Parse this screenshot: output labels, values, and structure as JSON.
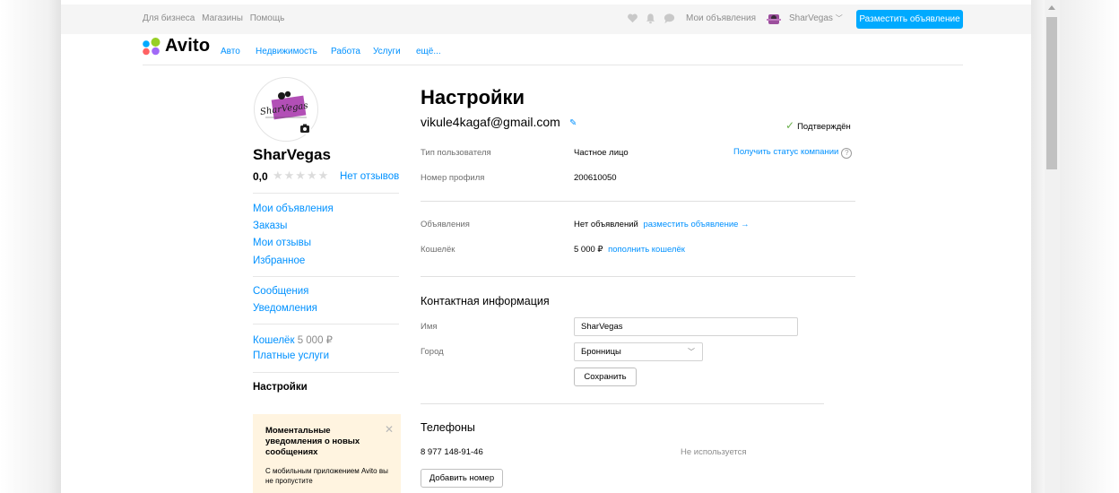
{
  "topbar": {
    "links": [
      "Для бизнеса",
      "Магазины",
      "Помощь"
    ],
    "icons": [
      "heart-icon",
      "bell-icon",
      "chat-icon"
    ],
    "my_ads": "Мои объявления",
    "username": "SharVegas",
    "post_button": "Разместить объявление"
  },
  "nav": {
    "logo": "Avito",
    "items": [
      "Авто",
      "Недвижимость",
      "Работа",
      "Услуги",
      "ещё..."
    ]
  },
  "sidebar": {
    "username": "SharVegas",
    "rating": "0,0",
    "stars": 0,
    "no_reviews": "Нет отзывов",
    "links_group1": [
      "Мои объявления",
      "Заказы",
      "Мои отзывы",
      "Избранное"
    ],
    "links_group2": [
      "Сообщения",
      "Уведомления"
    ],
    "wallet_label": "Кошелёк",
    "wallet_amount": "5 000 ₽",
    "paid_services": "Платные услуги",
    "current": "Настройки",
    "promo_title": "Моментальные уведомления о новых сообщениях",
    "promo_body": "С мобильным приложением Avito вы не пропустите"
  },
  "main": {
    "title": "Настройки",
    "email": "vikule4kagaf@gmail.com",
    "confirmed": "Подтверждён",
    "user_type_label": "Тип пользователя",
    "user_type_value": "Частное лицо",
    "company_status_link": "Получить статус компании",
    "profile_number_label": "Номер профиля",
    "profile_number_value": "200610050",
    "ads_label": "Объявления",
    "ads_value": "Нет объявлений",
    "ads_link": "разместить объявление →",
    "wallet_label": "Кошелёк",
    "wallet_value": "5 000 ₽",
    "wallet_link": "пополнить кошелёк",
    "contact_heading": "Контактная информация",
    "name_label": "Имя",
    "name_value": "SharVegas",
    "city_label": "Город",
    "city_value": "Бронницы",
    "save_button": "Сохранить",
    "phones_heading": "Телефоны",
    "phone_value": "8 977 148-91-46",
    "phone_status": "Не используется",
    "add_phone_button": "Добавить номер"
  },
  "colors": {
    "link": "#0091ff",
    "primary_button": "#00aaff",
    "promo_bg": "#fff4e0",
    "check": "#6ab04c"
  }
}
